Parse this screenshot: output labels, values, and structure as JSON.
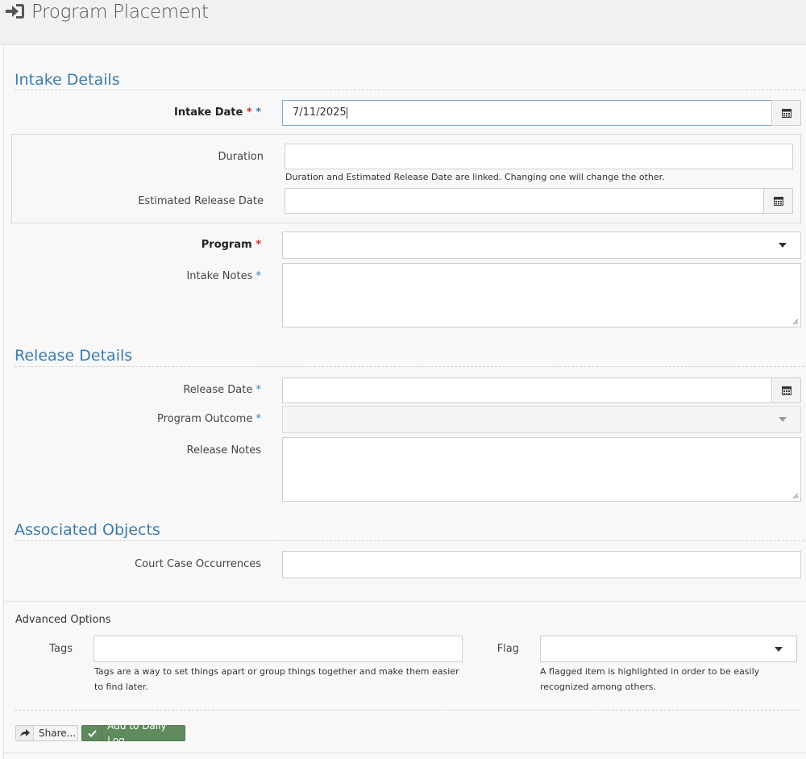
{
  "header": {
    "title": "Program Placement",
    "icon": "sign-in-icon"
  },
  "intake": {
    "section_title": "Intake Details",
    "intake_date_label": "Intake Date",
    "intake_date_value": "7/11/2025",
    "duration_label": "Duration",
    "duration_value": "",
    "linked_help": "Duration and Estimated Release Date are linked. Changing one will change the other.",
    "est_release_label": "Estimated Release Date",
    "est_release_value": "",
    "program_label": "Program",
    "program_value": "",
    "notes_label": "Intake Notes",
    "notes_value": ""
  },
  "release": {
    "section_title": "Release Details",
    "release_date_label": "Release Date",
    "release_date_value": "",
    "outcome_label": "Program Outcome",
    "outcome_value": "",
    "notes_label": "Release Notes",
    "notes_value": ""
  },
  "associated": {
    "section_title": "Associated Objects",
    "court_label": "Court Case Occurrences",
    "court_value": ""
  },
  "advanced": {
    "title": "Advanced Options",
    "tags_label": "Tags",
    "tags_value": "",
    "tags_help": "Tags are a way to set things apart or group things together and make them easier to find later.",
    "flag_label": "Flag",
    "flag_value": "",
    "flag_help": "A flagged item is highlighted in order to be easily recognized among others."
  },
  "actions": {
    "share_label": "Share...",
    "log_label": "Add to Daily Log"
  },
  "markers": {
    "asterisk": "*"
  },
  "colors": {
    "accent": "#3a7bb0",
    "required": "#d9282b",
    "log_button": "#5e8a5e"
  }
}
